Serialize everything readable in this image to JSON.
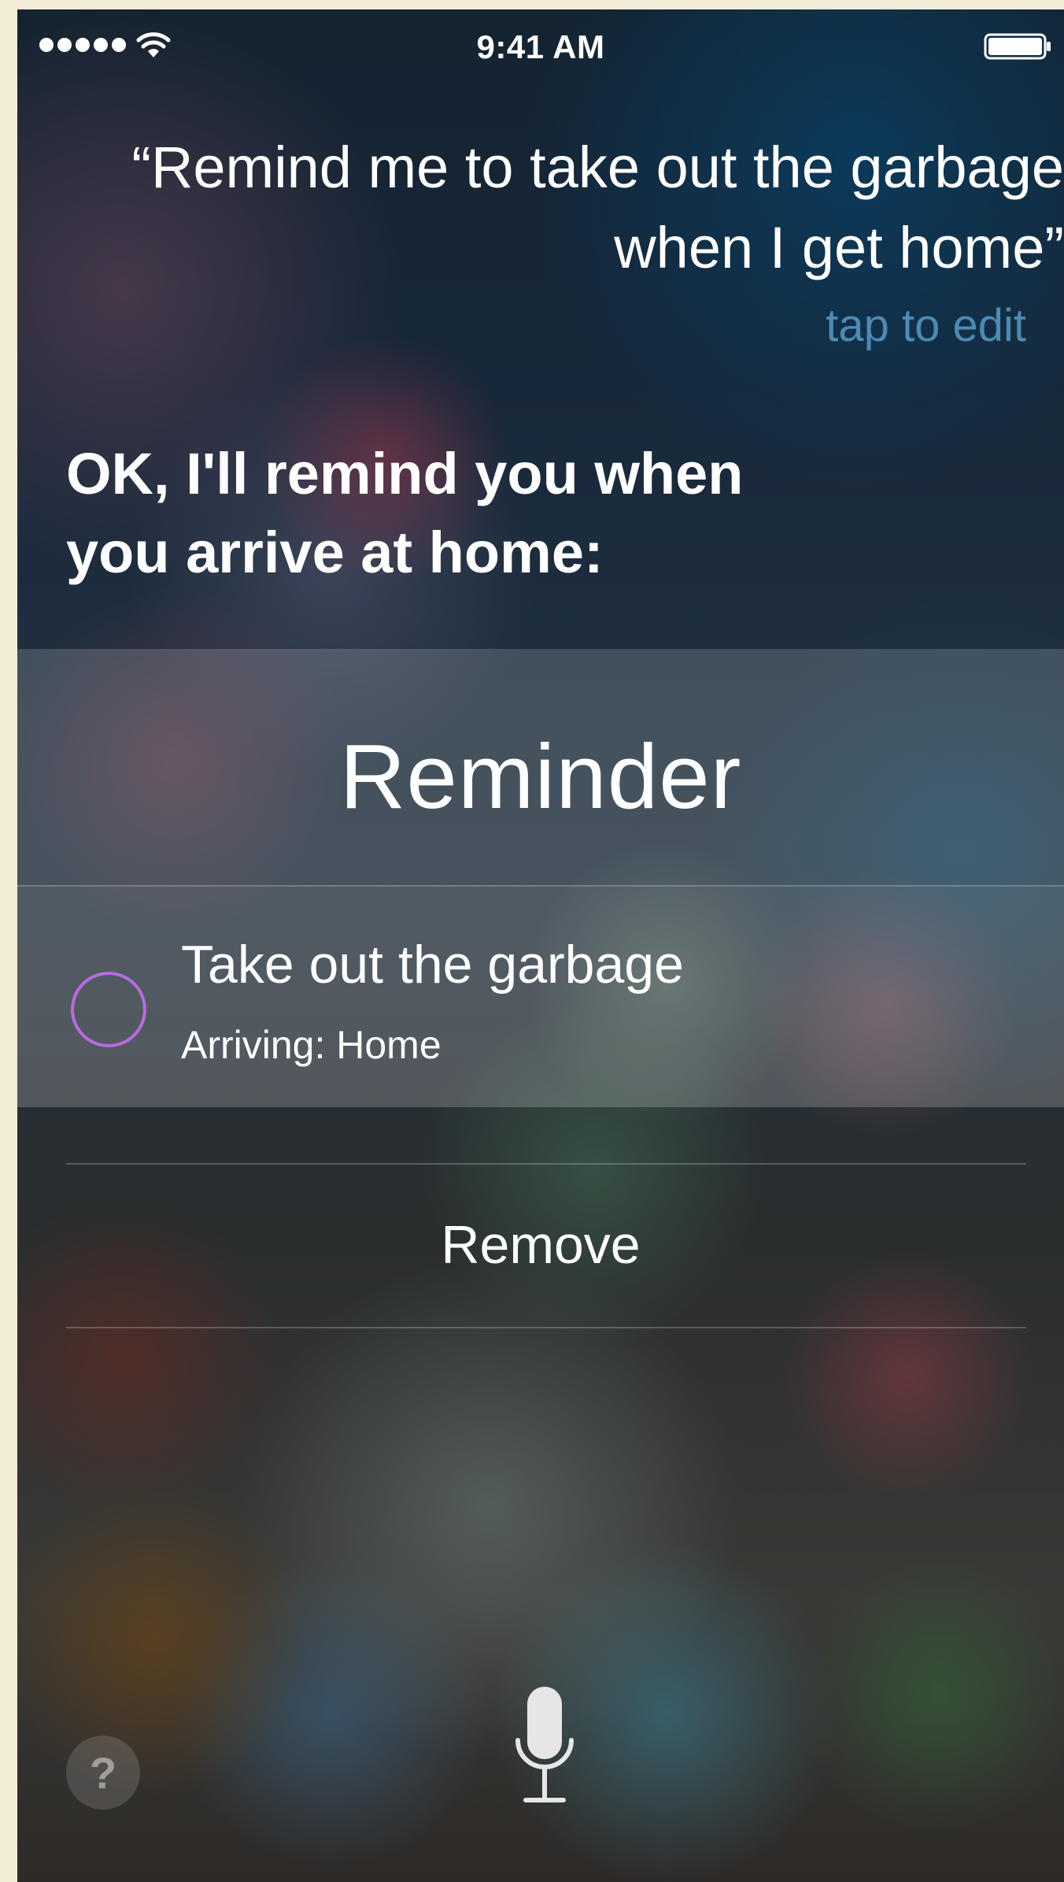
{
  "status_bar": {
    "time": "9:41 AM"
  },
  "siri": {
    "query": "“Remind me to take out the garbage when I get home”",
    "tap_to_edit": "tap to edit",
    "response_line1": "OK, I'll remind you when",
    "response_line2": "you arrive at home:"
  },
  "card": {
    "title": "Reminder",
    "reminder": {
      "title": "Take out the garbage",
      "subtitle": "Arriving: Home"
    },
    "checkbox_color": "#b96be0"
  },
  "actions": {
    "remove_label": "Remove"
  },
  "bottom": {
    "help_label": "?",
    "mic_icon": "microphone-icon"
  },
  "colors": {
    "accent_link": "#4d8ab4",
    "frame": "#f3ecd7"
  }
}
